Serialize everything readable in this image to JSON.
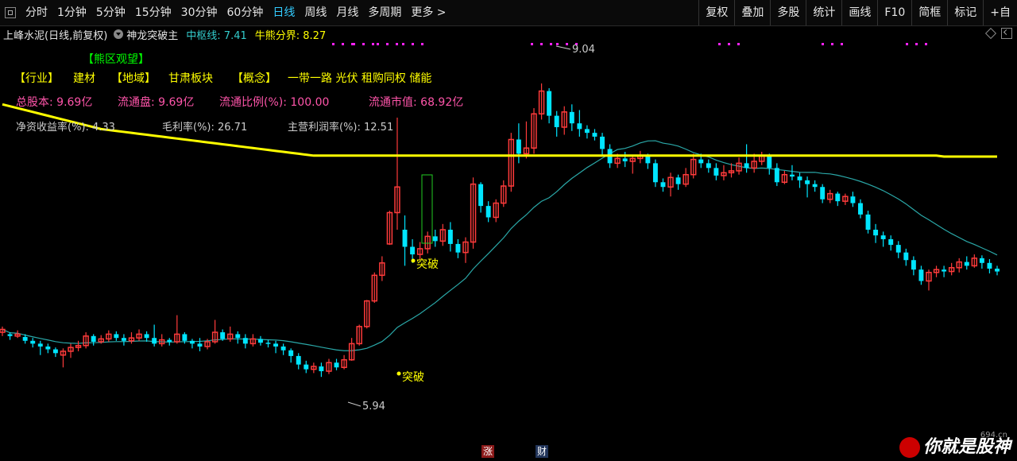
{
  "toolbar": {
    "periods": [
      "分时",
      "1分钟",
      "5分钟",
      "15分钟",
      "30分钟",
      "60分钟",
      "日线",
      "周线",
      "月线",
      "多周期",
      "更多 >"
    ],
    "active_period": "日线",
    "right_buttons": [
      "复权",
      "叠加",
      "多股",
      "统计",
      "画线",
      "F10",
      "简框",
      "标记",
      "+自"
    ]
  },
  "infobar": {
    "stock": "上峰水泥(日线,前复权)",
    "indicator": "神龙突破主",
    "mid_line": "中枢线: 7.41",
    "bear_line": "牛熊分界: 8.27"
  },
  "overlay": {
    "zone_label": "【熊区观望】",
    "industry_tag": "【行业】",
    "industry": "建材",
    "region_tag": "【地域】",
    "region": "甘肃板块",
    "concept_tag": "【概念】",
    "concepts": "一带一路 光伏 租购同权 储能",
    "total_shares": "总股本: 9.69亿",
    "float_shares": "流通盘: 9.69亿",
    "float_ratio": "流通比例(%): 100.00",
    "float_mcap": "流通市值: 68.92亿",
    "roe": "净资收益率(%): 4.33",
    "gross_margin": "毛利率(%): 26.71",
    "main_margin": "主营利润率(%): 12.51",
    "high_label": "9.04",
    "low_label": "5.94",
    "breakout_label": "突破"
  },
  "bottom": {
    "badge_up": "涨",
    "badge_fin": "财",
    "brand": "你就是股神",
    "site": "694.cn"
  },
  "colors": {
    "up": "#ff3b3b",
    "down": "#00e5ff",
    "bear_line": "#ffff00",
    "mid_line": "#2aa8a8"
  },
  "chart_data": {
    "type": "candlestick",
    "price_range": [
      5.6,
      9.4
    ],
    "bear_line": [
      8.82,
      8.8,
      8.78,
      8.76,
      8.74,
      8.72,
      8.7,
      8.68,
      8.66,
      8.64,
      8.62,
      8.6,
      8.58,
      8.56,
      8.55,
      8.54,
      8.53,
      8.52,
      8.51,
      8.5,
      8.49,
      8.48,
      8.47,
      8.46,
      8.45,
      8.44,
      8.43,
      8.42,
      8.41,
      8.4,
      8.39,
      8.38,
      8.37,
      8.36,
      8.35,
      8.34,
      8.33,
      8.32,
      8.31,
      8.3,
      8.29,
      8.28,
      8.28,
      8.28,
      8.28,
      8.28,
      8.28,
      8.28,
      8.28,
      8.28,
      8.28,
      8.28,
      8.28,
      8.28,
      8.28,
      8.28,
      8.28,
      8.28,
      8.28,
      8.28,
      8.28,
      8.28,
      8.28,
      8.28,
      8.28,
      8.28,
      8.28,
      8.28,
      8.28,
      8.28,
      8.28,
      8.28,
      8.28,
      8.28,
      8.28,
      8.28,
      8.28,
      8.28,
      8.28,
      8.28,
      8.28,
      8.28,
      8.28,
      8.28,
      8.28,
      8.28,
      8.28,
      8.28,
      8.28,
      8.28,
      8.28,
      8.28,
      8.28,
      8.28,
      8.28,
      8.28,
      8.28,
      8.28,
      8.28,
      8.28,
      8.28,
      8.28,
      8.28,
      8.28,
      8.28,
      8.28,
      8.28,
      8.28,
      8.28,
      8.28,
      8.28,
      8.28,
      8.28,
      8.28,
      8.28,
      8.28,
      8.28,
      8.28,
      8.28,
      8.28,
      8.28,
      8.28,
      8.28,
      8.28,
      8.27,
      8.27,
      8.27,
      8.27,
      8.27,
      8.27,
      8.27,
      8.27,
      8.27,
      8.27,
      8.27,
      8.27,
      8.27,
      8.27,
      8.27,
      8.27,
      8.27,
      8.27,
      8.27,
      8.27,
      8.27,
      8.27,
      8.27,
      8.27,
      8.27,
      8.27,
      8.27,
      8.27,
      8.27,
      8.27,
      8.27,
      8.27,
      8.27,
      8.27,
      8.27,
      8.27,
      8.27,
      8.27,
      8.27,
      8.27,
      8.27,
      8.27,
      8.27,
      8.27,
      8.27,
      8.27,
      8.27,
      8.27,
      8.27,
      8.27,
      8.27,
      8.27,
      8.27,
      8.27,
      8.27,
      8.27,
      8.27,
      8.27,
      8.27,
      8.27,
      8.27,
      8.27,
      8.27,
      8.27,
      8.27,
      8.27,
      8.27
    ],
    "candles": [
      {
        "o": 6.42,
        "c": 6.45,
        "h": 6.48,
        "l": 6.38
      },
      {
        "o": 6.4,
        "c": 6.38,
        "h": 6.42,
        "l": 6.34
      },
      {
        "o": 6.38,
        "c": 6.4,
        "h": 6.44,
        "l": 6.36
      },
      {
        "o": 6.37,
        "c": 6.33,
        "h": 6.4,
        "l": 6.3
      },
      {
        "o": 6.33,
        "c": 6.3,
        "h": 6.36,
        "l": 6.26
      },
      {
        "o": 6.3,
        "c": 6.27,
        "h": 6.33,
        "l": 6.18
      },
      {
        "o": 6.27,
        "c": 6.24,
        "h": 6.3,
        "l": 6.2
      },
      {
        "o": 6.24,
        "c": 6.2,
        "h": 6.26,
        "l": 6.16
      },
      {
        "o": 6.18,
        "c": 6.22,
        "h": 6.25,
        "l": 6.05
      },
      {
        "o": 6.22,
        "c": 6.26,
        "h": 6.3,
        "l": 6.15
      },
      {
        "o": 6.26,
        "c": 6.28,
        "h": 6.33,
        "l": 6.22
      },
      {
        "o": 6.28,
        "c": 6.38,
        "h": 6.42,
        "l": 6.25
      },
      {
        "o": 6.38,
        "c": 6.32,
        "h": 6.4,
        "l": 6.28
      },
      {
        "o": 6.32,
        "c": 6.35,
        "h": 6.39,
        "l": 6.3
      },
      {
        "o": 6.35,
        "c": 6.4,
        "h": 6.44,
        "l": 6.32
      },
      {
        "o": 6.4,
        "c": 6.36,
        "h": 6.43,
        "l": 6.33
      },
      {
        "o": 6.36,
        "c": 6.33,
        "h": 6.4,
        "l": 6.28
      },
      {
        "o": 6.33,
        "c": 6.36,
        "h": 6.42,
        "l": 6.3
      },
      {
        "o": 6.36,
        "c": 6.4,
        "h": 6.45,
        "l": 6.33
      },
      {
        "o": 6.4,
        "c": 6.36,
        "h": 6.43,
        "l": 6.32
      },
      {
        "o": 6.36,
        "c": 6.3,
        "h": 6.5,
        "l": 6.27
      },
      {
        "o": 6.3,
        "c": 6.34,
        "h": 6.4,
        "l": 6.27
      },
      {
        "o": 6.34,
        "c": 6.32,
        "h": 6.36,
        "l": 6.28
      },
      {
        "o": 6.32,
        "c": 6.4,
        "h": 6.6,
        "l": 6.3
      },
      {
        "o": 6.4,
        "c": 6.33,
        "h": 6.42,
        "l": 6.3
      },
      {
        "o": 6.33,
        "c": 6.3,
        "h": 6.35,
        "l": 6.25
      },
      {
        "o": 6.3,
        "c": 6.27,
        "h": 6.36,
        "l": 6.22
      },
      {
        "o": 6.27,
        "c": 6.32,
        "h": 6.35,
        "l": 6.24
      },
      {
        "o": 6.32,
        "c": 6.42,
        "h": 6.55,
        "l": 6.3
      },
      {
        "o": 6.42,
        "c": 6.35,
        "h": 6.45,
        "l": 6.33
      },
      {
        "o": 6.35,
        "c": 6.4,
        "h": 6.48,
        "l": 6.32
      },
      {
        "o": 6.4,
        "c": 6.36,
        "h": 6.43,
        "l": 6.3
      },
      {
        "o": 6.36,
        "c": 6.3,
        "h": 6.4,
        "l": 6.25
      },
      {
        "o": 6.3,
        "c": 6.35,
        "h": 6.4,
        "l": 6.27
      },
      {
        "o": 6.35,
        "c": 6.31,
        "h": 6.38,
        "l": 6.28
      },
      {
        "o": 6.31,
        "c": 6.3,
        "h": 6.34,
        "l": 6.26
      },
      {
        "o": 6.3,
        "c": 6.27,
        "h": 6.33,
        "l": 6.2
      },
      {
        "o": 6.27,
        "c": 6.23,
        "h": 6.3,
        "l": 6.18
      },
      {
        "o": 6.23,
        "c": 6.17,
        "h": 6.25,
        "l": 6.1
      },
      {
        "o": 6.17,
        "c": 6.08,
        "h": 6.2,
        "l": 6.03
      },
      {
        "o": 6.08,
        "c": 6.03,
        "h": 6.12,
        "l": 5.99
      },
      {
        "o": 6.03,
        "c": 6.06,
        "h": 6.1,
        "l": 5.99
      },
      {
        "o": 6.06,
        "c": 6.01,
        "h": 6.1,
        "l": 5.95
      },
      {
        "o": 6.01,
        "c": 6.1,
        "h": 6.14,
        "l": 5.98
      },
      {
        "o": 6.1,
        "c": 6.05,
        "h": 6.14,
        "l": 6.02
      },
      {
        "o": 6.05,
        "c": 6.13,
        "h": 6.18,
        "l": 6.03
      },
      {
        "o": 6.13,
        "c": 6.3,
        "h": 6.36,
        "l": 6.12
      },
      {
        "o": 6.3,
        "c": 6.48,
        "h": 6.5,
        "l": 6.28
      },
      {
        "o": 6.48,
        "c": 6.75,
        "h": 6.76,
        "l": 6.46
      },
      {
        "o": 6.75,
        "c": 7.02,
        "h": 7.05,
        "l": 6.73
      },
      {
        "o": 7.02,
        "c": 7.15,
        "h": 7.22,
        "l": 6.96
      },
      {
        "o": 7.35,
        "c": 7.68,
        "h": 7.7,
        "l": 7.34
      },
      {
        "o": 7.68,
        "c": 7.95,
        "h": 8.68,
        "l": 7.5
      },
      {
        "o": 7.5,
        "c": 7.32,
        "h": 7.65,
        "l": 7.12
      },
      {
        "o": 7.32,
        "c": 7.24,
        "h": 7.4,
        "l": 7.15
      },
      {
        "o": 7.24,
        "c": 7.3,
        "h": 7.37,
        "l": 7.18
      },
      {
        "o": 7.3,
        "c": 7.43,
        "h": 7.48,
        "l": 7.25
      },
      {
        "o": 7.43,
        "c": 7.38,
        "h": 7.5,
        "l": 7.32
      },
      {
        "o": 7.38,
        "c": 7.5,
        "h": 7.56,
        "l": 7.33
      },
      {
        "o": 7.5,
        "c": 7.35,
        "h": 7.58,
        "l": 7.27
      },
      {
        "o": 7.35,
        "c": 7.26,
        "h": 7.4,
        "l": 7.2
      },
      {
        "o": 7.26,
        "c": 7.37,
        "h": 7.42,
        "l": 7.15
      },
      {
        "o": 7.37,
        "c": 7.98,
        "h": 8.05,
        "l": 7.3
      },
      {
        "o": 7.98,
        "c": 7.75,
        "h": 8.0,
        "l": 7.68
      },
      {
        "o": 7.75,
        "c": 7.63,
        "h": 7.8,
        "l": 7.58
      },
      {
        "o": 7.63,
        "c": 7.78,
        "h": 7.82,
        "l": 7.58
      },
      {
        "o": 7.78,
        "c": 7.96,
        "h": 8.02,
        "l": 7.74
      },
      {
        "o": 7.96,
        "c": 8.45,
        "h": 8.52,
        "l": 7.9
      },
      {
        "o": 8.45,
        "c": 8.3,
        "h": 8.62,
        "l": 8.2
      },
      {
        "o": 8.3,
        "c": 8.36,
        "h": 8.64,
        "l": 8.25
      },
      {
        "o": 8.36,
        "c": 8.72,
        "h": 8.78,
        "l": 8.3
      },
      {
        "o": 8.72,
        "c": 8.96,
        "h": 9.04,
        "l": 8.66
      },
      {
        "o": 8.96,
        "c": 8.7,
        "h": 8.99,
        "l": 8.62
      },
      {
        "o": 8.7,
        "c": 8.58,
        "h": 8.75,
        "l": 8.48
      },
      {
        "o": 8.58,
        "c": 8.74,
        "h": 8.8,
        "l": 8.5
      },
      {
        "o": 8.74,
        "c": 8.62,
        "h": 8.82,
        "l": 8.54
      },
      {
        "o": 8.62,
        "c": 8.56,
        "h": 8.76,
        "l": 8.48
      },
      {
        "o": 8.56,
        "c": 8.52,
        "h": 8.6,
        "l": 8.46
      },
      {
        "o": 8.52,
        "c": 8.48,
        "h": 8.56,
        "l": 8.44
      },
      {
        "o": 8.48,
        "c": 8.35,
        "h": 8.52,
        "l": 8.28
      },
      {
        "o": 8.35,
        "c": 8.2,
        "h": 8.4,
        "l": 8.15
      },
      {
        "o": 8.2,
        "c": 8.25,
        "h": 8.3,
        "l": 8.15
      },
      {
        "o": 8.25,
        "c": 8.22,
        "h": 8.32,
        "l": 8.16
      },
      {
        "o": 8.22,
        "c": 8.25,
        "h": 8.29,
        "l": 8.09
      },
      {
        "o": 8.25,
        "c": 8.28,
        "h": 8.33,
        "l": 8.2
      },
      {
        "o": 8.28,
        "c": 8.2,
        "h": 8.3,
        "l": 8.14
      },
      {
        "o": 8.2,
        "c": 8.0,
        "h": 8.24,
        "l": 7.95
      },
      {
        "o": 8.0,
        "c": 7.95,
        "h": 8.04,
        "l": 7.9
      },
      {
        "o": 7.95,
        "c": 8.05,
        "h": 8.1,
        "l": 7.85
      },
      {
        "o": 8.05,
        "c": 7.98,
        "h": 8.08,
        "l": 7.92
      },
      {
        "o": 7.98,
        "c": 8.08,
        "h": 8.15,
        "l": 7.95
      },
      {
        "o": 8.08,
        "c": 8.24,
        "h": 8.3,
        "l": 8.04
      },
      {
        "o": 8.24,
        "c": 8.2,
        "h": 8.3,
        "l": 8.15
      },
      {
        "o": 8.2,
        "c": 8.15,
        "h": 8.24,
        "l": 8.1
      },
      {
        "o": 8.15,
        "c": 8.07,
        "h": 8.2,
        "l": 8.02
      },
      {
        "o": 8.07,
        "c": 8.1,
        "h": 8.18,
        "l": 8.02
      },
      {
        "o": 8.1,
        "c": 8.12,
        "h": 8.2,
        "l": 8.05
      },
      {
        "o": 8.12,
        "c": 8.2,
        "h": 8.26,
        "l": 8.08
      },
      {
        "o": 8.2,
        "c": 8.15,
        "h": 8.4,
        "l": 8.1
      },
      {
        "o": 8.15,
        "c": 8.22,
        "h": 8.3,
        "l": 8.1
      },
      {
        "o": 8.22,
        "c": 8.28,
        "h": 8.32,
        "l": 8.18
      },
      {
        "o": 8.28,
        "c": 8.15,
        "h": 8.3,
        "l": 8.08
      },
      {
        "o": 8.15,
        "c": 8.0,
        "h": 8.2,
        "l": 7.96
      },
      {
        "o": 8.0,
        "c": 8.08,
        "h": 8.12,
        "l": 7.98
      },
      {
        "o": 8.08,
        "c": 8.06,
        "h": 8.18,
        "l": 8.02
      },
      {
        "o": 8.06,
        "c": 8.02,
        "h": 8.1,
        "l": 7.94
      },
      {
        "o": 8.02,
        "c": 7.98,
        "h": 8.06,
        "l": 7.84
      },
      {
        "o": 7.98,
        "c": 7.95,
        "h": 8.02,
        "l": 7.9
      },
      {
        "o": 7.95,
        "c": 7.82,
        "h": 7.98,
        "l": 7.78
      },
      {
        "o": 7.82,
        "c": 7.88,
        "h": 7.92,
        "l": 7.78
      },
      {
        "o": 7.88,
        "c": 7.8,
        "h": 7.9,
        "l": 7.75
      },
      {
        "o": 7.8,
        "c": 7.85,
        "h": 7.88,
        "l": 7.76
      },
      {
        "o": 7.85,
        "c": 7.78,
        "h": 7.9,
        "l": 7.74
      },
      {
        "o": 7.78,
        "c": 7.66,
        "h": 7.82,
        "l": 7.62
      },
      {
        "o": 7.66,
        "c": 7.5,
        "h": 7.7,
        "l": 7.46
      },
      {
        "o": 7.5,
        "c": 7.44,
        "h": 7.56,
        "l": 7.36
      },
      {
        "o": 7.44,
        "c": 7.4,
        "h": 7.48,
        "l": 7.32
      },
      {
        "o": 7.4,
        "c": 7.34,
        "h": 7.44,
        "l": 7.28
      },
      {
        "o": 7.34,
        "c": 7.26,
        "h": 7.38,
        "l": 7.2
      },
      {
        "o": 7.26,
        "c": 7.18,
        "h": 7.3,
        "l": 7.12
      },
      {
        "o": 7.18,
        "c": 7.08,
        "h": 7.22,
        "l": 7.02
      },
      {
        "o": 7.08,
        "c": 6.96,
        "h": 7.12,
        "l": 6.92
      },
      {
        "o": 6.96,
        "c": 7.05,
        "h": 7.08,
        "l": 6.86
      },
      {
        "o": 7.05,
        "c": 7.08,
        "h": 7.12,
        "l": 7.0
      },
      {
        "o": 7.08,
        "c": 7.06,
        "h": 7.12,
        "l": 7.0
      },
      {
        "o": 7.06,
        "c": 7.1,
        "h": 7.15,
        "l": 7.02
      },
      {
        "o": 7.1,
        "c": 7.16,
        "h": 7.2,
        "l": 7.05
      },
      {
        "o": 7.16,
        "c": 7.12,
        "h": 7.22,
        "l": 7.08
      },
      {
        "o": 7.12,
        "c": 7.2,
        "h": 7.24,
        "l": 7.1
      },
      {
        "o": 7.2,
        "c": 7.15,
        "h": 7.23,
        "l": 7.09
      },
      {
        "o": 7.15,
        "c": 7.09,
        "h": 7.19,
        "l": 7.04
      },
      {
        "o": 7.09,
        "c": 7.06,
        "h": 7.12,
        "l": 7.02
      }
    ]
  }
}
